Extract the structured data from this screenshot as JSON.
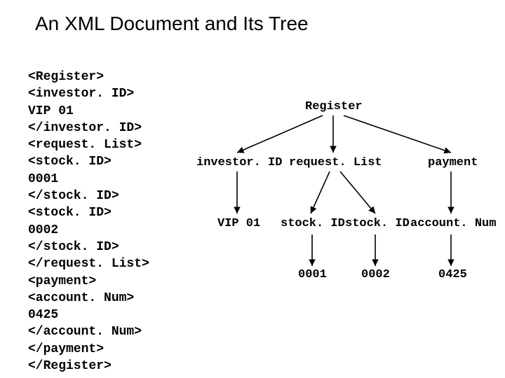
{
  "title": "An XML Document and  Its Tree",
  "xml_lines": [
    "<Register>",
    "<investor. ID>",
    "VIP 01",
    "</investor. ID>",
    "<request. List>",
    "<stock. ID>",
    "0001",
    "</stock. ID>",
    "<stock. ID>",
    "0002",
    "</stock. ID>",
    "</request. List>",
    "<payment>",
    "<account. Num>",
    "0425",
    "</account. Num>",
    "</payment>",
    "</Register>"
  ],
  "tree": {
    "root": "Register",
    "level1": {
      "a": "investor. ID",
      "b": "request. List",
      "c": "payment"
    },
    "level2": {
      "a": "VIP 01",
      "b": "stock. ID",
      "c": "stock. ID",
      "d": "account. Num"
    },
    "level3": {
      "a": "0001",
      "b": "0002",
      "c": "0425"
    }
  }
}
